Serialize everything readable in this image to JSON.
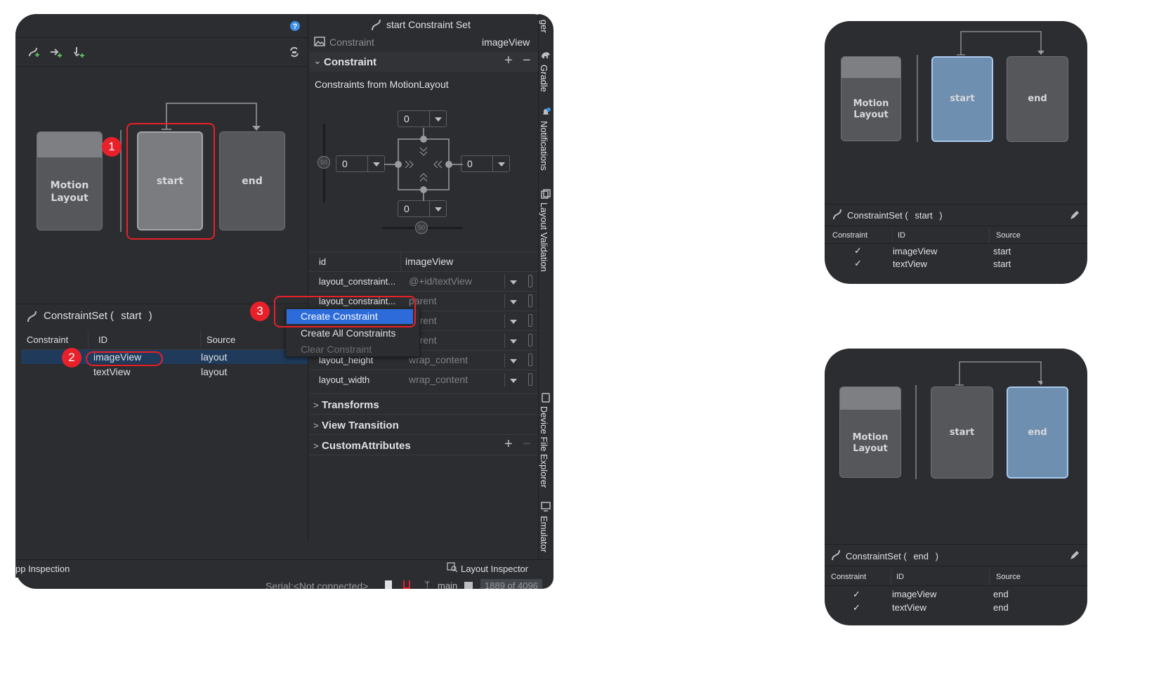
{
  "main": {
    "help_icon": "question-icon",
    "toolbar": {
      "create_constraintset_icon": "constraintset-add-icon",
      "create_transition_icon": "transition-add-icon",
      "create_click_icon": "click-handler-add-icon",
      "cycle_icon": "cycle-icon"
    },
    "graph": {
      "motion_layout_label_1": "Motion",
      "motion_layout_label_2": "Layout",
      "start_label": "start",
      "end_label": "end"
    },
    "constraintset_panel": {
      "title_prefix": "ConstraintSet (",
      "title_name": "start",
      "title_suffix": ")",
      "headers": [
        "Constraint",
        "ID",
        "Source"
      ],
      "rows": [
        {
          "id": "imageView",
          "source": "layout"
        },
        {
          "id": "textView",
          "source": "layout"
        }
      ]
    },
    "context_menu": {
      "items": [
        "Create Constraint",
        "Create All Constraints",
        "Clear Constraint"
      ]
    },
    "attributes": {
      "header_title": "start Constraint Set",
      "subheader_type": "Constraint",
      "subheader_id": "imageView",
      "constraint_section": "Constraint",
      "constraints_from": "Constraints from MotionLayout",
      "top_value": "0",
      "left_value": "0",
      "right_value": "0",
      "bottom_value": "0",
      "bias_vertical": "50",
      "bias_horizontal": "50",
      "id_key": "id",
      "id_value": "imageView",
      "rows": [
        {
          "key": "layout_constraint...",
          "value": "@+id/textView"
        },
        {
          "key": "layout_constraint...",
          "value": "parent"
        },
        {
          "key": "layout_constraint...",
          "value": "parent"
        },
        {
          "key": "layout_constraint...",
          "value": "parent"
        },
        {
          "key": "layout_height",
          "value": "wrap_content"
        },
        {
          "key": "layout_width",
          "value": "wrap_content"
        }
      ],
      "sections": [
        "Transforms",
        "View Transition",
        "CustomAttributes"
      ]
    },
    "side_tabs": [
      "Gradle",
      "Notifications",
      "Layout Validation",
      "Device File Explorer",
      "Emulator"
    ],
    "side_tab_top_fragment": "ger",
    "bottom_bar": {
      "app_inspection": "pp Inspection",
      "layout_inspector": "Layout Inspector",
      "serial": "Serial:<Not connected>",
      "branch": "main",
      "memory": "1889 of 4096"
    },
    "badges": [
      "1",
      "2",
      "3"
    ]
  },
  "card_start": {
    "motion_1": "Motion",
    "motion_2": "Layout",
    "start_label": "start",
    "end_label": "end",
    "title_prefix": "ConstraintSet (",
    "title_name": "start",
    "title_suffix": ")",
    "headers": [
      "Constraint",
      "ID",
      "Source"
    ],
    "rows": [
      {
        "id": "imageView",
        "source": "start"
      },
      {
        "id": "textView",
        "source": "start"
      }
    ]
  },
  "card_end": {
    "motion_1": "Motion",
    "motion_2": "Layout",
    "start_label": "start",
    "end_label": "end",
    "title_prefix": "ConstraintSet (",
    "title_name": "end",
    "title_suffix": ")",
    "headers": [
      "Constraint",
      "ID",
      "Source"
    ],
    "rows": [
      {
        "id": "imageView",
        "source": "end"
      },
      {
        "id": "textView",
        "source": "end"
      }
    ]
  },
  "colors": {
    "panel_bg": "#2b2d30",
    "graph_bg": "#2b2d30",
    "selected_blue": "#6f8fb0",
    "selected_border": "#a9c8ee",
    "menu_highlight": "#2d6bdb",
    "badge_red": "#e8202a"
  }
}
